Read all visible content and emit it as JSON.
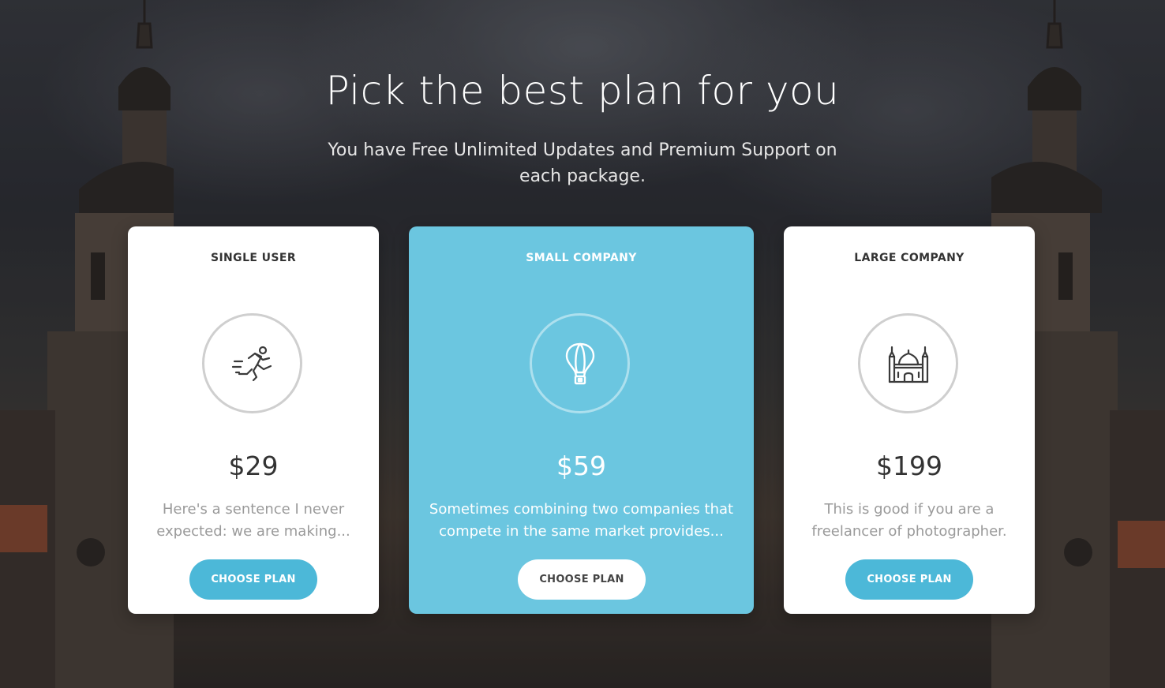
{
  "page": {
    "title": "Pick the best plan for you",
    "subtitle": "You have Free Unlimited Updates and Premium Support on each package."
  },
  "plans": [
    {
      "name": "SINGLE USER",
      "icon": "runner-icon",
      "price": "$29",
      "description": "Here's a sentence I never expected: we are making...",
      "button_label": "CHOOSE PLAN",
      "featured": false
    },
    {
      "name": "SMALL COMPANY",
      "icon": "hot-air-balloon-icon",
      "price": "$59",
      "description": "Sometimes combining two companies that compete in the same market provides...",
      "button_label": "CHOOSE PLAN",
      "featured": true
    },
    {
      "name": "LARGE COMPANY",
      "icon": "mosque-icon",
      "price": "$199",
      "description": "This is good if you are a freelancer of photographer.",
      "button_label": "CHOOSE PLAN",
      "featured": false
    }
  ],
  "colors": {
    "accent": "#4cb8d8",
    "featured_card": "#6bc6e0",
    "card": "#ffffff",
    "text_dark": "#333333",
    "text_muted": "#9a9a9a"
  }
}
